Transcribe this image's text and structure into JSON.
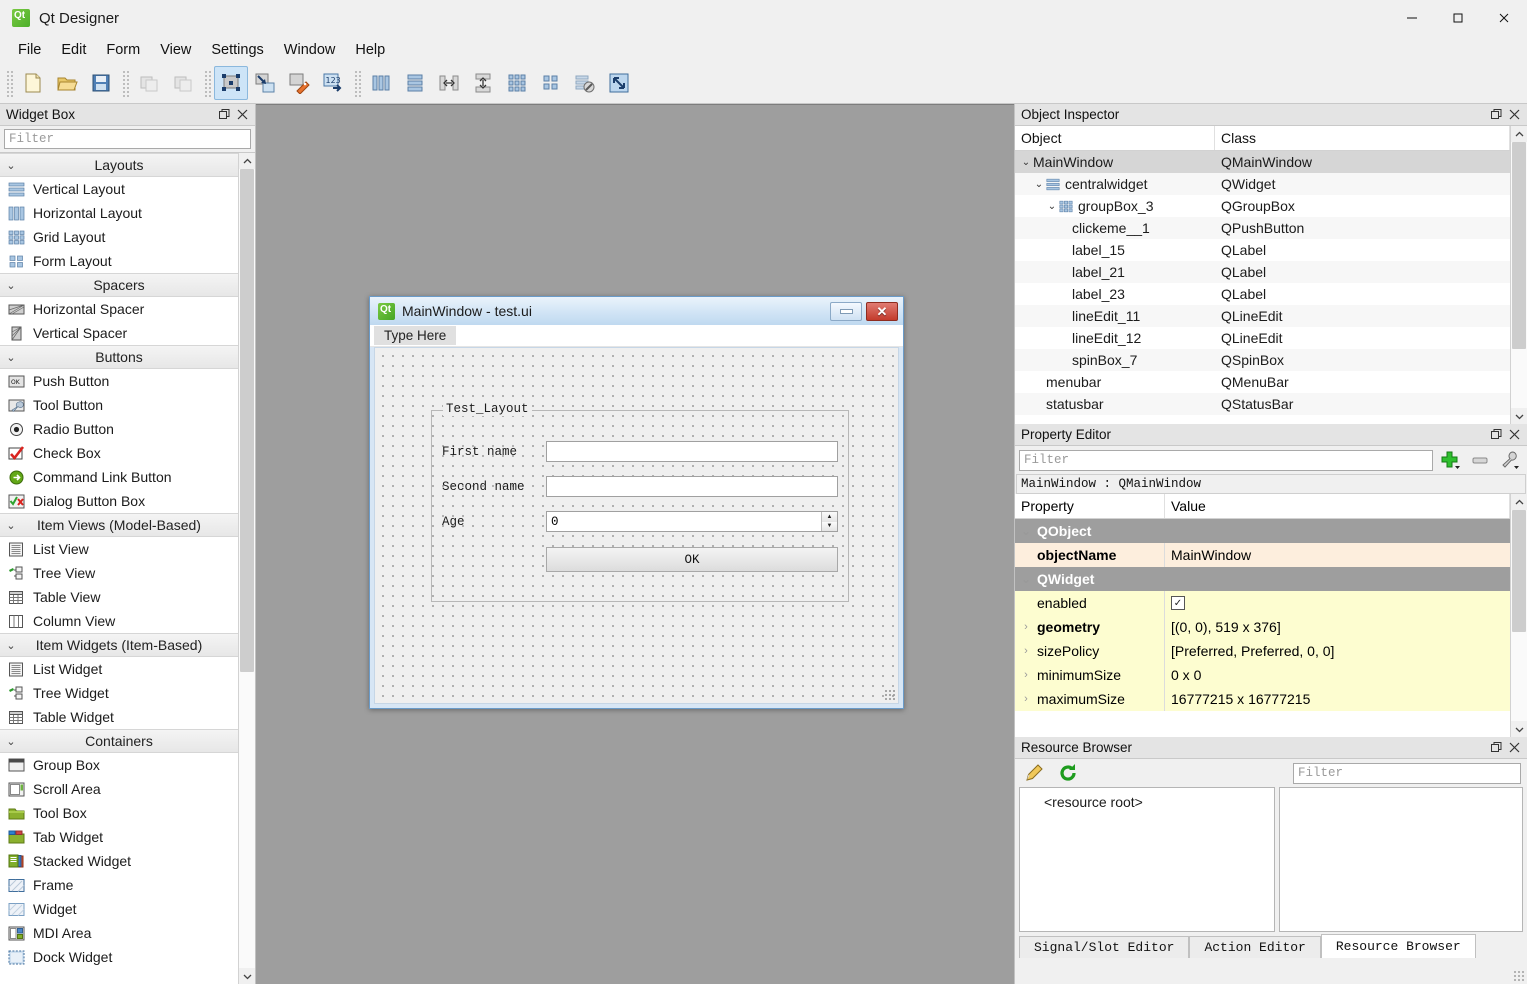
{
  "window": {
    "title": "Qt Designer",
    "app_icon": "qt-logo-icon",
    "minimize_label": "minimize-icon",
    "maximize_label": "maximize-icon",
    "close_label": "close-icon"
  },
  "menubar": {
    "items": [
      "File",
      "Edit",
      "Form",
      "View",
      "Settings",
      "Window",
      "Help"
    ]
  },
  "toolbar": {
    "groups": [
      {
        "buttons": [
          {
            "name": "new-form-icon",
            "tip": "New"
          },
          {
            "name": "open-form-icon",
            "tip": "Open"
          },
          {
            "name": "save-form-icon",
            "tip": "Save"
          }
        ]
      },
      {
        "buttons": [
          {
            "name": "undo-icon",
            "tip": "Undo"
          },
          {
            "name": "redo-icon",
            "tip": "Redo"
          }
        ]
      },
      {
        "buttons": [
          {
            "name": "edit-widgets-icon",
            "tip": "Edit Widgets",
            "active": true
          },
          {
            "name": "edit-signals-slots-icon",
            "tip": "Edit Signals/Slots"
          },
          {
            "name": "edit-buddies-icon",
            "tip": "Edit Buddies"
          },
          {
            "name": "edit-tab-order-icon",
            "tip": "Edit Tab Order"
          }
        ]
      },
      {
        "buttons": [
          {
            "name": "layout-horizontally-icon",
            "tip": "Lay Out Horizontally"
          },
          {
            "name": "layout-vertically-icon",
            "tip": "Lay Out Vertically"
          },
          {
            "name": "layout-splitter-horizontal-icon",
            "tip": "Lay Out Horizontally in Splitter"
          },
          {
            "name": "layout-splitter-vertical-icon",
            "tip": "Lay Out Vertically in Splitter"
          },
          {
            "name": "layout-grid-icon",
            "tip": "Lay Out in a Grid"
          },
          {
            "name": "layout-form-icon",
            "tip": "Lay Out in a Form Layout"
          },
          {
            "name": "break-layout-icon",
            "tip": "Break Layout"
          },
          {
            "name": "adjust-size-icon",
            "tip": "Adjust Size"
          }
        ]
      }
    ]
  },
  "widget_box": {
    "title": "Widget Box",
    "float_icon": "undock-icon",
    "close_icon": "close-icon",
    "filter_placeholder": "Filter",
    "categories": [
      {
        "label": "Layouts",
        "expanded": true,
        "items": [
          {
            "label": "Vertical Layout",
            "icon": "vertical-layout-icon"
          },
          {
            "label": "Horizontal Layout",
            "icon": "horizontal-layout-icon"
          },
          {
            "label": "Grid Layout",
            "icon": "grid-layout-icon"
          },
          {
            "label": "Form Layout",
            "icon": "form-layout-icon"
          }
        ]
      },
      {
        "label": "Spacers",
        "expanded": true,
        "items": [
          {
            "label": "Horizontal Spacer",
            "icon": "horizontal-spacer-icon"
          },
          {
            "label": "Vertical Spacer",
            "icon": "vertical-spacer-icon"
          }
        ]
      },
      {
        "label": "Buttons",
        "expanded": true,
        "items": [
          {
            "label": "Push Button",
            "icon": "push-button-icon"
          },
          {
            "label": "Tool Button",
            "icon": "tool-button-icon"
          },
          {
            "label": "Radio Button",
            "icon": "radio-button-icon"
          },
          {
            "label": "Check Box",
            "icon": "check-box-icon"
          },
          {
            "label": "Command Link Button",
            "icon": "command-link-button-icon"
          },
          {
            "label": "Dialog Button Box",
            "icon": "dialog-button-box-icon"
          }
        ]
      },
      {
        "label": "Item Views (Model-Based)",
        "expanded": true,
        "items": [
          {
            "label": "List View",
            "icon": "list-view-icon"
          },
          {
            "label": "Tree View",
            "icon": "tree-view-icon"
          },
          {
            "label": "Table View",
            "icon": "table-view-icon"
          },
          {
            "label": "Column View",
            "icon": "column-view-icon"
          }
        ]
      },
      {
        "label": "Item Widgets (Item-Based)",
        "expanded": true,
        "items": [
          {
            "label": "List Widget",
            "icon": "list-widget-icon"
          },
          {
            "label": "Tree Widget",
            "icon": "tree-widget-icon"
          },
          {
            "label": "Table Widget",
            "icon": "table-widget-icon"
          }
        ]
      },
      {
        "label": "Containers",
        "expanded": true,
        "items": [
          {
            "label": "Group Box",
            "icon": "group-box-icon"
          },
          {
            "label": "Scroll Area",
            "icon": "scroll-area-icon"
          },
          {
            "label": "Tool Box",
            "icon": "tool-box-icon"
          },
          {
            "label": "Tab Widget",
            "icon": "tab-widget-icon"
          },
          {
            "label": "Stacked Widget",
            "icon": "stacked-widget-icon"
          },
          {
            "label": "Frame",
            "icon": "frame-icon"
          },
          {
            "label": "Widget",
            "icon": "widget-icon"
          },
          {
            "label": "MDI Area",
            "icon": "mdi-area-icon"
          },
          {
            "label": "Dock Widget",
            "icon": "dock-widget-icon"
          }
        ]
      }
    ]
  },
  "form_window": {
    "title": "MainWindow - test.ui",
    "app_icon": "qt-logo-icon",
    "minimize_label": "minimize-icon",
    "close_label": "close-icon",
    "menu_placeholder": "Type Here",
    "group_box": {
      "title": "Test_Layout",
      "rows": [
        {
          "label": "First name",
          "value": "",
          "type": "lineedit"
        },
        {
          "label": "Second name",
          "value": "",
          "type": "lineedit"
        },
        {
          "label": "Age",
          "value": "0",
          "type": "spinbox"
        }
      ],
      "button": "OK"
    }
  },
  "object_inspector": {
    "title": "Object Inspector",
    "float_icon": "undock-icon",
    "close_icon": "close-icon",
    "columns": [
      "Object",
      "Class"
    ],
    "rows": [
      {
        "object": "MainWindow",
        "class": "QMainWindow",
        "indent": 0,
        "chevron": "v",
        "icon": "",
        "selected": true
      },
      {
        "object": "centralwidget",
        "class": "QWidget",
        "indent": 1,
        "chevron": "v",
        "icon": "break-layout-icon"
      },
      {
        "object": "groupBox_3",
        "class": "QGroupBox",
        "indent": 2,
        "chevron": "v",
        "icon": "grid-layout-icon"
      },
      {
        "object": "clickeme__1",
        "class": "QPushButton",
        "indent": 3,
        "chevron": "",
        "icon": ""
      },
      {
        "object": "label_15",
        "class": "QLabel",
        "indent": 3,
        "chevron": "",
        "icon": ""
      },
      {
        "object": "label_21",
        "class": "QLabel",
        "indent": 3,
        "chevron": "",
        "icon": ""
      },
      {
        "object": "label_23",
        "class": "QLabel",
        "indent": 3,
        "chevron": "",
        "icon": ""
      },
      {
        "object": "lineEdit_11",
        "class": "QLineEdit",
        "indent": 3,
        "chevron": "",
        "icon": ""
      },
      {
        "object": "lineEdit_12",
        "class": "QLineEdit",
        "indent": 3,
        "chevron": "",
        "icon": ""
      },
      {
        "object": "spinBox_7",
        "class": "QSpinBox",
        "indent": 3,
        "chevron": "",
        "icon": ""
      },
      {
        "object": "menubar",
        "class": "QMenuBar",
        "indent": 1,
        "chevron": "",
        "icon": ""
      },
      {
        "object": "statusbar",
        "class": "QStatusBar",
        "indent": 1,
        "chevron": "",
        "icon": ""
      }
    ]
  },
  "property_editor": {
    "title": "Property Editor",
    "float_icon": "undock-icon",
    "close_icon": "close-icon",
    "filter_placeholder": "Filter",
    "add_icon": "add-dynamic-property-icon",
    "remove_icon": "remove-dynamic-property-icon",
    "config_icon": "configure-icon",
    "object_line": "MainWindow : QMainWindow",
    "columns": [
      "Property",
      "Value"
    ],
    "rows": [
      {
        "name": "QObject",
        "value": "",
        "kind": "group"
      },
      {
        "name": "objectName",
        "value": "MainWindow",
        "kind": "orange",
        "bold": true
      },
      {
        "name": "QWidget",
        "value": "",
        "kind": "group"
      },
      {
        "name": "enabled",
        "value": "",
        "kind": "yellow",
        "checkbox": true
      },
      {
        "name": "geometry",
        "value": "[(0, 0), 519 x 376]",
        "kind": "yellow",
        "bold": true,
        "expandable": true
      },
      {
        "name": "sizePolicy",
        "value": "[Preferred, Preferred, 0, 0]",
        "kind": "yellow",
        "expandable": true
      },
      {
        "name": "minimumSize",
        "value": "0 x 0",
        "kind": "yellow",
        "expandable": true
      },
      {
        "name": "maximumSize",
        "value": "16777215 x 16777215",
        "kind": "yellow",
        "expandable": true
      }
    ]
  },
  "resource_browser": {
    "title": "Resource Browser",
    "float_icon": "undock-icon",
    "close_icon": "close-icon",
    "edit_icon": "pencil-edit-icon",
    "reload_icon": "reload-icon",
    "filter_placeholder": "Filter",
    "root_label": "<resource root>",
    "tabs": [
      {
        "label": "Signal/Slot Editor",
        "active": false
      },
      {
        "label": "Action Editor",
        "active": false
      },
      {
        "label": "Resource Browser",
        "active": true
      }
    ]
  }
}
